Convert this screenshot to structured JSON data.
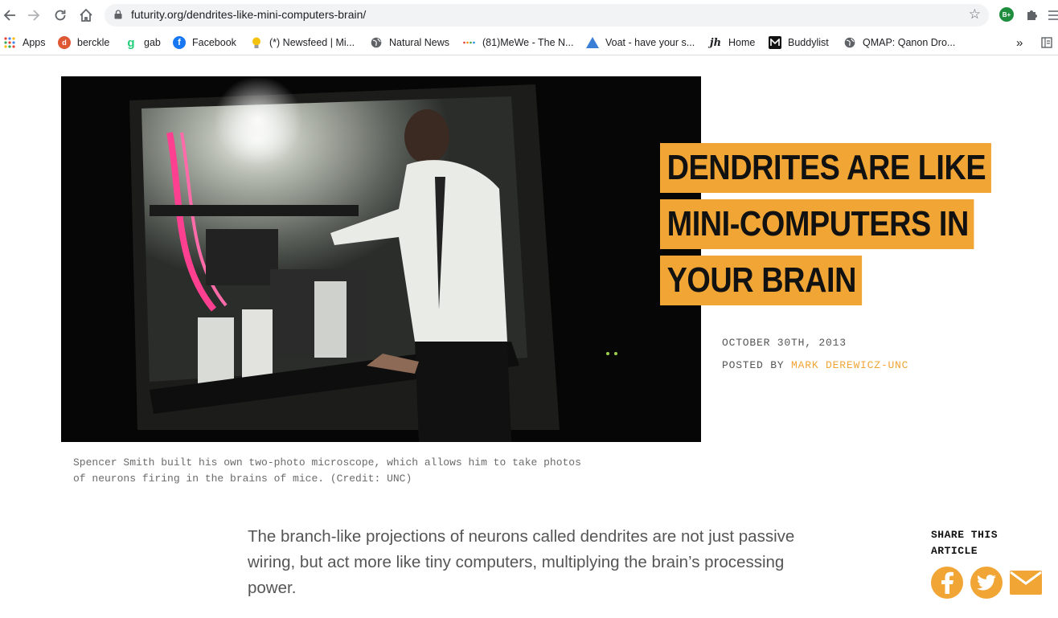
{
  "browser": {
    "url": "futurity.org/dendrites-like-mini-computers-brain/",
    "extension_badge": "B+",
    "bookmarks": [
      {
        "label": "Apps",
        "icon": "apps-grid-icon"
      },
      {
        "label": "berckle",
        "icon": "duckduckgo-icon"
      },
      {
        "label": "gab",
        "icon": "gab-icon"
      },
      {
        "label": "Facebook",
        "icon": "facebook-icon"
      },
      {
        "label": "(*) Newsfeed | Mi...",
        "icon": "lightbulb-icon"
      },
      {
        "label": "Natural News",
        "icon": "globe-icon"
      },
      {
        "label": "(81)MeWe - The N...",
        "icon": "mewe-dots-icon"
      },
      {
        "label": "Voat - have your s...",
        "icon": "voat-triangle-icon"
      },
      {
        "label": "Home",
        "icon": "jh-icon"
      },
      {
        "label": "Buddylist",
        "icon": "buddylist-icon"
      },
      {
        "label": "QMAP: Qanon Dro...",
        "icon": "globe-icon"
      }
    ],
    "overflow_label": "»"
  },
  "article": {
    "title_lines": [
      "DENDRITES ARE LIKE",
      "MINI-COMPUTERS IN",
      "YOUR BRAIN"
    ],
    "date": "OCTOBER 30TH, 2013",
    "posted_by_label": "POSTED BY",
    "author": "MARK DEREWICZ-UNC",
    "caption_lines": [
      "Spencer Smith built his own two-photo microscope, which allows him to take photos",
      "of neurons firing in the brains of mice. (Credit: UNC)"
    ],
    "lead_lines": [
      "The branch-like projections of neurons called dendrites are not just passive",
      "wiring, but act more like tiny computers, multiplying the brain’s processing",
      "power."
    ],
    "share_label_lines": [
      "SHARE THIS",
      "ARTICLE"
    ]
  },
  "colors": {
    "accent": "#f0a535",
    "text_gray": "#555555"
  }
}
